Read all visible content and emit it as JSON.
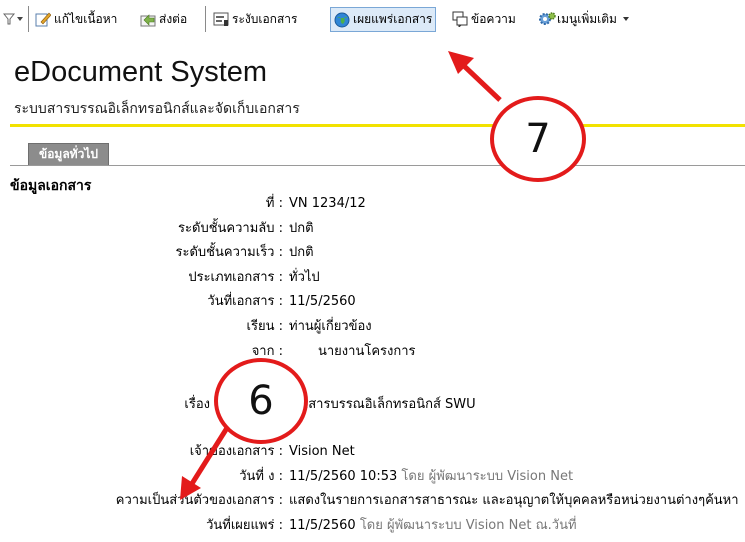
{
  "toolbar": {
    "items": [
      {
        "label": "แก้ไขเนื้อหา",
        "icon": "edit-icon"
      },
      {
        "label": "ส่งต่อ",
        "icon": "forward-icon"
      },
      {
        "label": "ระงับเอกสาร",
        "icon": "suspend-icon"
      },
      {
        "label": "เผยแพร่เอกสาร",
        "icon": "globe-icon"
      },
      {
        "label": "ข้อความ",
        "icon": "message-icon"
      },
      {
        "label": "เมนูเพิ่มเติม",
        "icon": "gear-icon"
      }
    ]
  },
  "header": {
    "title": "eDocument System",
    "subtitle": "ระบบสารบรรณอิเล็กทรอนิกส์และจัดเก็บเอกสาร"
  },
  "tabs": [
    {
      "label": "ข้อมูลทั่วไป"
    }
  ],
  "section": {
    "heading": "ข้อมูลเอกสาร"
  },
  "fields": [
    {
      "label": "ที่ :",
      "value": "VN 1234/12",
      "meta": ""
    },
    {
      "label": "ระดับชั้นความลับ :",
      "value": "ปกติ",
      "meta": ""
    },
    {
      "label": "ระดับชั้นความเร็ว :",
      "value": "ปกติ",
      "meta": ""
    },
    {
      "label": "ประเภทเอกสาร :",
      "value": "ทั่วไป",
      "meta": ""
    },
    {
      "label": "วันที่เอกสาร :",
      "value": "11/5/2560",
      "meta": ""
    },
    {
      "label": "เรียน :",
      "value": "ท่านผู้เกี่ยวข้อง",
      "meta": ""
    },
    {
      "label": "จาก :",
      "value": "นายงานโครงการ",
      "meta": ""
    },
    {
      "label": "เรื่อง",
      "value": "บสารบรรณอิเล็กทรอนิกส์ SWU",
      "meta": ""
    },
    {
      "label": "เจ้าของเอกสาร :",
      "value": "Vision Net",
      "meta": ""
    },
    {
      "label": "วันที่ ง :",
      "value": "11/5/2560 10:53",
      "meta": "โดย ผู้พัฒนาระบบ Vision Net"
    },
    {
      "label": "ความเป็นส่วนตัวของเอกสาร :",
      "value": "แสดงในรายการเอกสารสาธารณะ และอนุญาตให้บุคคลหรือหน่วยงานต่างๆค้นหา",
      "meta": ""
    },
    {
      "label": "วันที่เผยแพร่ :",
      "value": "11/5/2560",
      "meta": "โดย ผู้พัฒนาระบบ Vision Net ณ.วันที่"
    }
  ],
  "annotations": [
    {
      "number": "7"
    },
    {
      "number": "6"
    }
  ],
  "colors": {
    "accent_line": "#f2e200",
    "callout": "#e31b1b",
    "active_toolbar": "#dceaf8"
  }
}
